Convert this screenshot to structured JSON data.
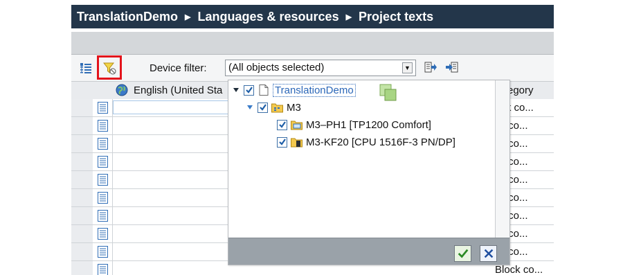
{
  "breadcrumb": {
    "items": [
      "TranslationDemo",
      "Languages & resources",
      "Project texts"
    ],
    "separator": "▶"
  },
  "toolbar": {
    "device_filter_label": "Device filter:",
    "device_filter_value": "(All objects selected)"
  },
  "grid": {
    "columns": {
      "english": "English (United Sta",
      "category": "egory"
    },
    "rows": [
      {
        "category": "ock co..."
      },
      {
        "category": "ck co..."
      },
      {
        "category": "ck co..."
      },
      {
        "category": "ck co..."
      },
      {
        "category": "ck co..."
      },
      {
        "category": "ck co..."
      },
      {
        "category": "ck co..."
      },
      {
        "category": "ck co..."
      },
      {
        "category": "ck co..."
      },
      {
        "category": "Block co..."
      }
    ]
  },
  "device_tree": {
    "nodes": [
      {
        "label": "TranslationDemo",
        "checked": true,
        "icon": "project-icon"
      },
      {
        "label": "M3",
        "checked": true,
        "icon": "folder-icon"
      },
      {
        "label": "M3–PH1 [TP1200 Comfort]",
        "checked": true,
        "icon": "hmi-device-icon"
      },
      {
        "label": "M3-KF20 [CPU 1516F-3 PN/DP]",
        "checked": true,
        "icon": "plc-device-icon"
      }
    ]
  },
  "colors": {
    "titlebar": "#23364a",
    "highlight": "#e3131b",
    "selection": "#2b67b8",
    "ok_green": "#2a8a24",
    "cancel_blue": "#1f4fa0"
  }
}
